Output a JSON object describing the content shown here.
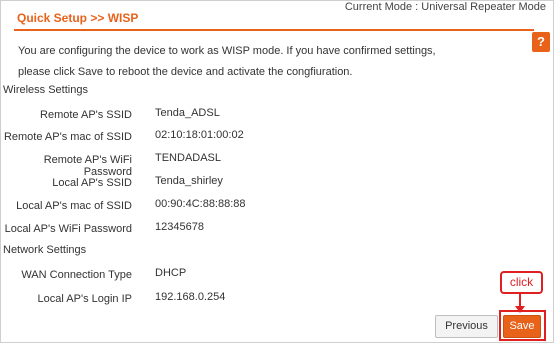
{
  "header": {
    "current_mode": "Current Mode : Universal Repeater Mode",
    "title": "Quick Setup >>  WISP",
    "help": "?"
  },
  "intro": {
    "line1": "You are configuring the device to work as WISP mode. If you have confirmed settings,",
    "line2": "please click Save to reboot the device and activate the congfiuration."
  },
  "wireless": {
    "heading": "Wireless Settings",
    "rows": [
      {
        "label": "Remote AP's SSID",
        "value": "Tenda_ADSL"
      },
      {
        "label": "Remote AP's mac of SSID",
        "value": "02:10:18:01:00:02"
      },
      {
        "label": "Remote AP's WiFi Password",
        "value": "TENDADASL"
      },
      {
        "label": "Local AP's SSID",
        "value": "Tenda_shirley"
      },
      {
        "label": "Local AP's mac of SSID",
        "value": "00:90:4C:88:88:88"
      },
      {
        "label": "Local AP's WiFi Password",
        "value": "12345678"
      }
    ]
  },
  "network": {
    "heading": "Network Settings",
    "rows": [
      {
        "label": "WAN Connection Type",
        "value": "DHCP"
      },
      {
        "label": "Local AP's Login IP",
        "value": "192.168.0.254"
      }
    ]
  },
  "buttons": {
    "previous": "Previous",
    "save": "Save"
  },
  "annotation": {
    "click": "click"
  },
  "colors": {
    "accent": "#e8621a",
    "annotation": "#e02020"
  }
}
